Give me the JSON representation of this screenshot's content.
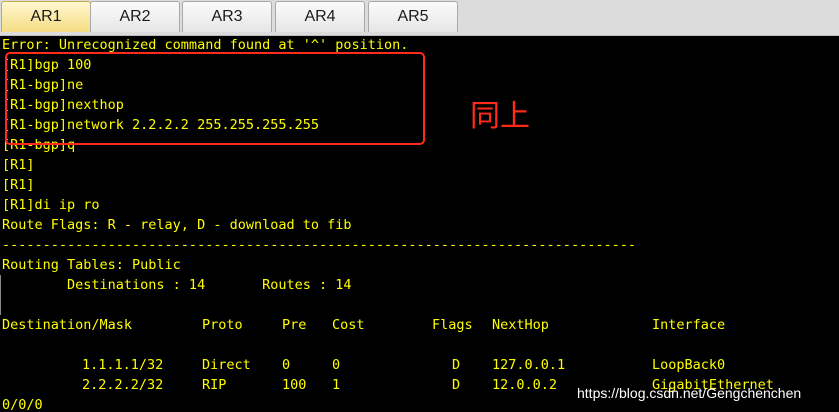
{
  "tabs": [
    "AR1",
    "AR2",
    "AR3",
    "AR4",
    "AR5"
  ],
  "terminal_lines": [
    "Error: Unrecognized command found at '^' position.",
    "[R1]bgp 100",
    "[R1-bgp]ne",
    "[R1-bgp]nexthop",
    "[R1-bgp]network 2.2.2.2 255.255.255.255",
    "[R1-bgp]q",
    "[R1]",
    "[R1]",
    "[R1]di ip ro",
    "Route Flags: R - relay, D - download to fib",
    "------------------------------------------------------------------------------",
    "Routing Tables: Public",
    "        Destinations : 14       Routes : 14",
    ""
  ],
  "route_table": {
    "headers": [
      "Destination/Mask",
      "Proto",
      "Pre",
      "Cost",
      "Flags",
      "NextHop",
      "Interface"
    ],
    "rows": [
      [
        "1.1.1.1/32",
        "Direct",
        "0",
        "0",
        "D",
        "127.0.0.1",
        "LoopBack0"
      ],
      [
        "2.2.2.2/32",
        "RIP",
        "100",
        "1",
        "D",
        "12.0.0.2",
        "GigabitEthernet"
      ]
    ],
    "continuation": "0/0/0"
  },
  "annotation": {
    "note_text": "同上"
  },
  "watermark": "https://blog.csdn.net/Gengchenchen"
}
